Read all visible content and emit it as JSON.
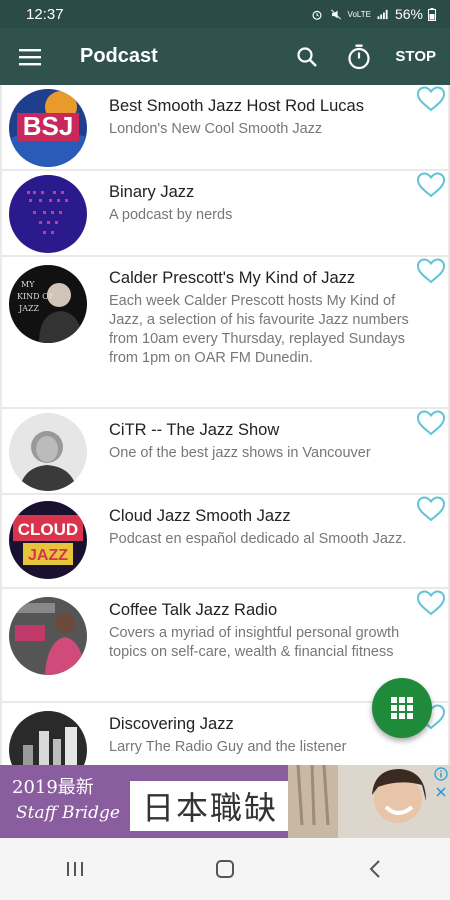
{
  "status_bar": {
    "time": "12:37",
    "battery": "56%",
    "network": "VoLTE"
  },
  "app_bar": {
    "title": "Podcast",
    "stop_label": "STOP"
  },
  "podcasts": [
    {
      "title": "Best Smooth Jazz Host Rod Lucas",
      "description": "London's New Cool Smooth Jazz"
    },
    {
      "title": "Binary Jazz",
      "description": "A podcast by nerds"
    },
    {
      "title": "Calder Prescott's My Kind of Jazz",
      "description": "Each week Calder Prescott hosts My Kind of Jazz, a selection of his favourite Jazz numbers from 10am every Thursday, replayed Sundays from 1pm on OAR FM Dunedin."
    },
    {
      "title": "CiTR -- The Jazz Show",
      "description": "One of the best jazz shows in Vancouver"
    },
    {
      "title": "Cloud Jazz Smooth Jazz",
      "description": "Podcast en español dedicado al Smooth Jazz."
    },
    {
      "title": "Coffee Talk Jazz Radio",
      "description": "Covers a myriad of insightful personal growth topics on self-care, wealth & financial fitness"
    },
    {
      "title": "Discovering Jazz",
      "description": "Larry The Radio Guy and the listener"
    }
  ],
  "ad": {
    "year_text": "2019最新",
    "brand": "Staff Bridge",
    "headline": "日本職缺"
  },
  "colors": {
    "app_bar": "#2f524f",
    "status_bar": "#2b4b48",
    "favorite": "#5fc4d6",
    "fab": "#1e8a3a",
    "ad_background": "#8a5e9e"
  },
  "icons": {
    "menu": "hamburger-icon",
    "search": "search-icon",
    "timer": "timer-icon",
    "favorite": "heart-outline-icon",
    "fab": "grid-icon"
  }
}
